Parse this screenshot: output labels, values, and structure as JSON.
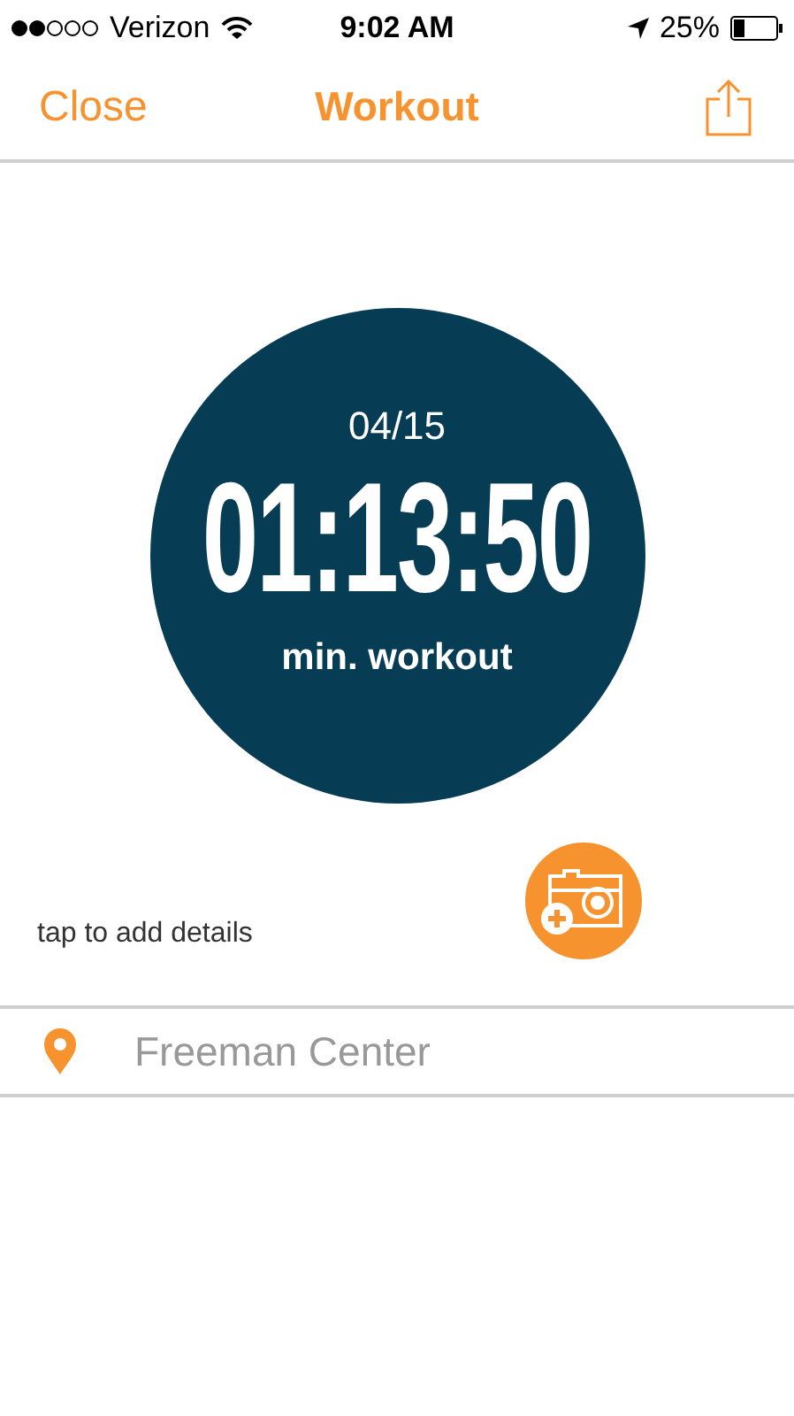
{
  "status_bar": {
    "carrier": "Verizon",
    "time": "9:02 AM",
    "battery_percent": "25%"
  },
  "nav_bar": {
    "left_button": "Close",
    "title": "Workout"
  },
  "workout": {
    "date": "04/15",
    "duration": "01:13:50",
    "caption": "min. workout"
  },
  "details_hint": "tap to add details",
  "location": {
    "name": "Freeman Center"
  }
}
